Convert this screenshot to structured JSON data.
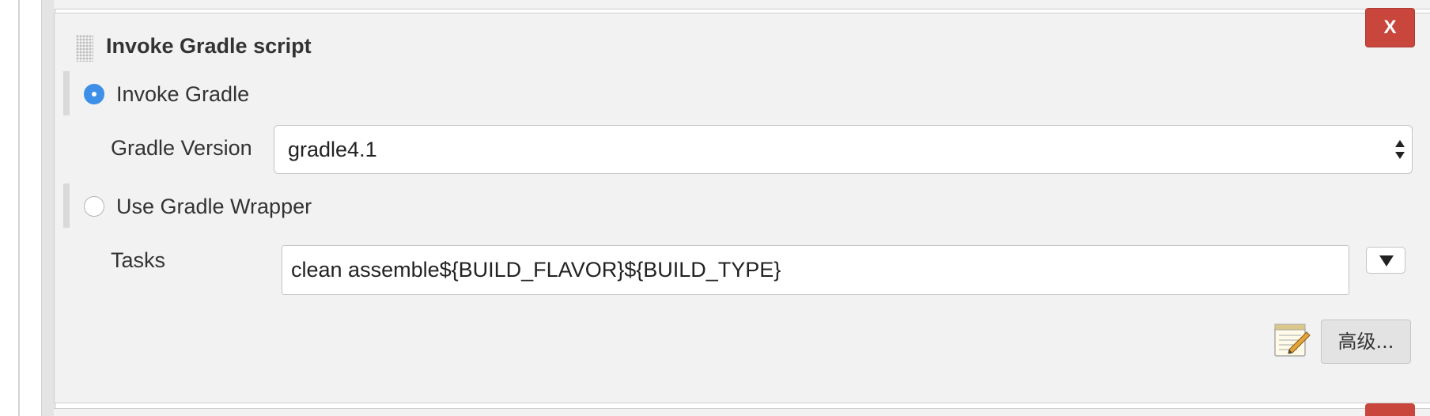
{
  "step": {
    "title": "Invoke Gradle script",
    "delete_label": "X"
  },
  "options": {
    "invoke_gradle": {
      "label": "Invoke Gradle",
      "checked": true
    },
    "gradle_version": {
      "label": "Gradle Version",
      "selected": "gradle4.1"
    },
    "use_wrapper": {
      "label": "Use Gradle Wrapper",
      "checked": false
    }
  },
  "tasks": {
    "label": "Tasks",
    "value": "clean assemble${BUILD_FLAVOR}${BUILD_TYPE}"
  },
  "advanced": {
    "label": "高级..."
  },
  "icons": {
    "handle": "drag-handle-icon",
    "expand": "chevron-down-icon",
    "notepad": "notepad-pencil-icon",
    "select_arrows": "up-down-arrows-icon"
  },
  "colors": {
    "delete_button": "#c9463d",
    "radio_checked": "#3d8fe8",
    "panel_bg": "#f2f2f2"
  }
}
